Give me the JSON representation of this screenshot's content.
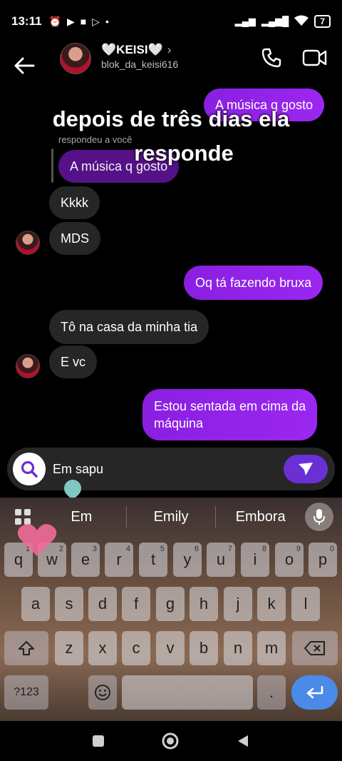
{
  "status": {
    "time": "13:11",
    "battery": "7"
  },
  "header": {
    "name": "🤍KEISI🤍",
    "chevron": "›",
    "handle": "blok_da_keisi616"
  },
  "overlay": {
    "line1": "depois de três dias ela",
    "line2": "responde"
  },
  "messages": {
    "m1": "A música q gosto",
    "reply_label": "respondeu a você",
    "m2_quoted": "A música q gosto",
    "m3": "Kkkk",
    "m4": "MDS",
    "m5": "Oq tá fazendo bruxa",
    "m6": "Tô na casa da minha tia",
    "m7": "E vc",
    "m8_l1": "Estou sentada em cima da",
    "m8_l2": "máquina"
  },
  "composer": {
    "value": "Em sapu"
  },
  "keyboard": {
    "suggestions": [
      "Em",
      "Emily",
      "Embora"
    ],
    "row1": [
      {
        "k": "q",
        "n": "1"
      },
      {
        "k": "w",
        "n": "2"
      },
      {
        "k": "e",
        "n": "3"
      },
      {
        "k": "r",
        "n": "4"
      },
      {
        "k": "t",
        "n": "5"
      },
      {
        "k": "y",
        "n": "6"
      },
      {
        "k": "u",
        "n": "7"
      },
      {
        "k": "i",
        "n": "8"
      },
      {
        "k": "o",
        "n": "9"
      },
      {
        "k": "p",
        "n": "0"
      }
    ],
    "row2": [
      "a",
      "s",
      "d",
      "f",
      "g",
      "h",
      "j",
      "k",
      "l"
    ],
    "row3": [
      "z",
      "x",
      "c",
      "v",
      "b",
      "n",
      "m"
    ],
    "symbols": "?123",
    "period": "."
  }
}
